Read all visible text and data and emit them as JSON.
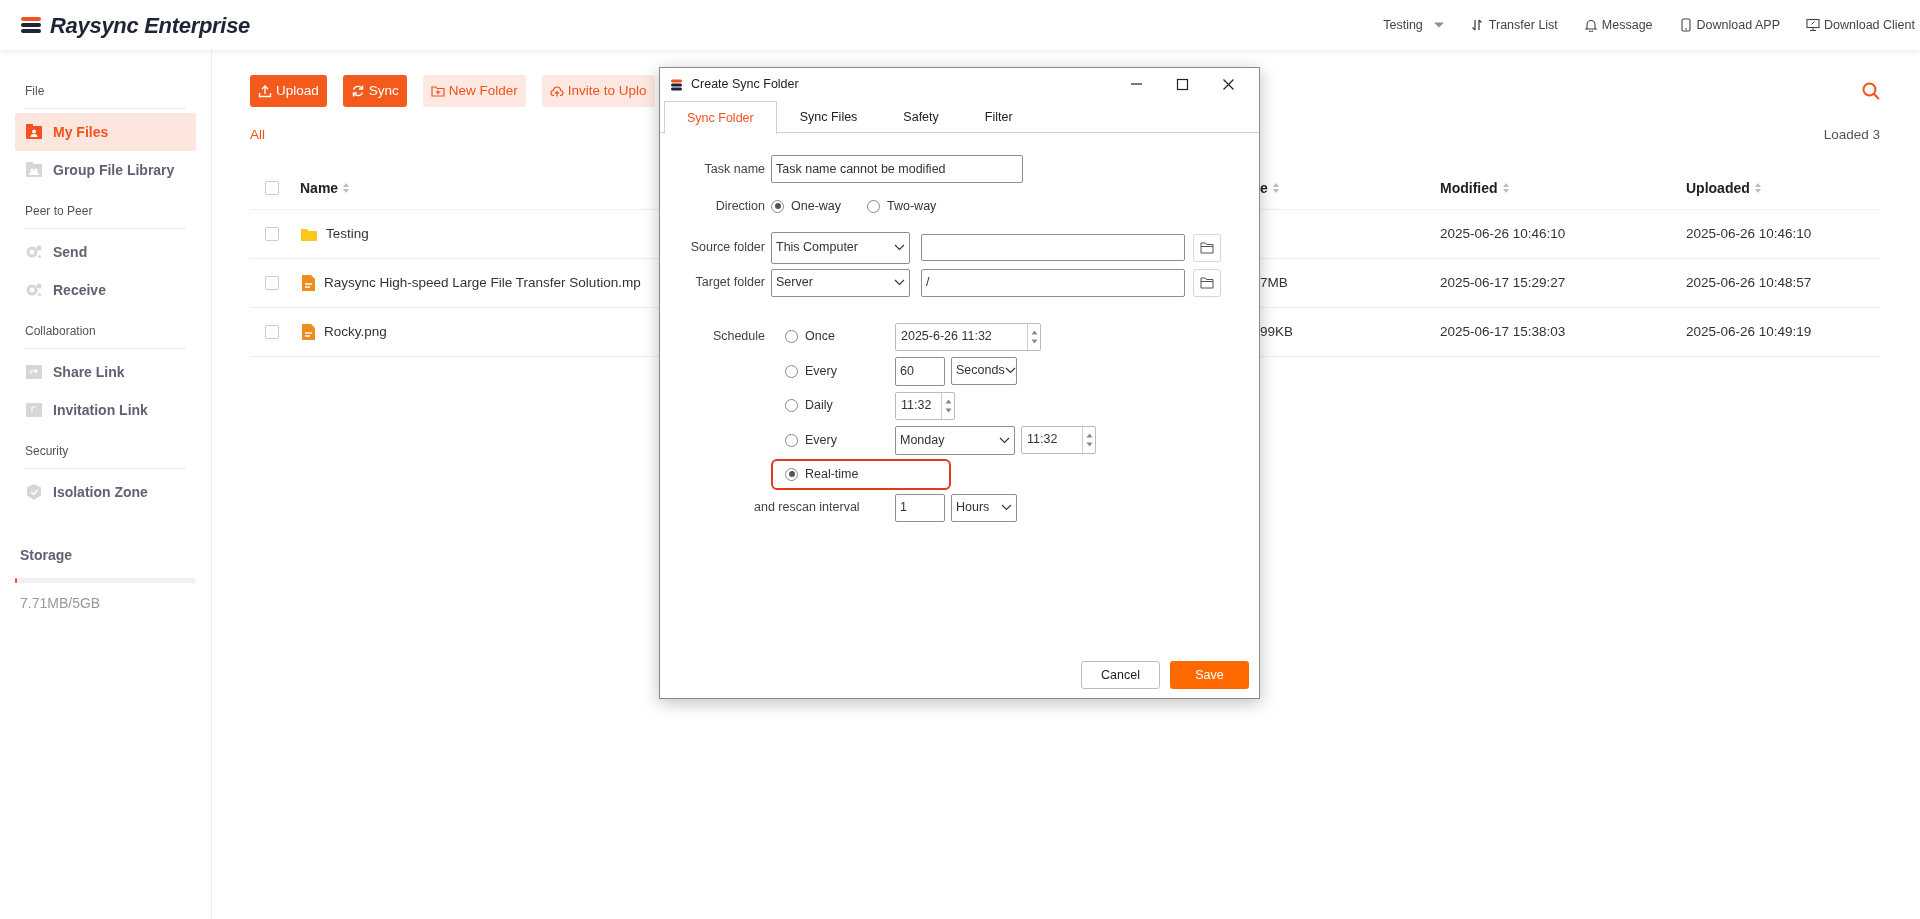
{
  "header": {
    "brand": "Raysync Enterprise",
    "nav": [
      {
        "label": "Testing",
        "kind": "dropdown"
      },
      {
        "label": "Transfer List",
        "kind": "transfer"
      },
      {
        "label": "Message",
        "kind": "bell"
      },
      {
        "label": "Download APP",
        "kind": "phone"
      },
      {
        "label": "Download Client",
        "kind": "monitor"
      }
    ]
  },
  "sidebar": {
    "sections": [
      {
        "title": "File",
        "items": [
          {
            "label": "My Files",
            "kind": "files",
            "selected": true
          },
          {
            "label": "Group File Library",
            "kind": "group",
            "selected": false
          }
        ]
      },
      {
        "title": "Peer to Peer",
        "items": [
          {
            "label": "Send",
            "kind": "send",
            "selected": false
          },
          {
            "label": "Receive",
            "kind": "send",
            "selected": false
          }
        ]
      },
      {
        "title": "Collaboration",
        "items": [
          {
            "label": "Share Link",
            "kind": "share",
            "selected": false
          },
          {
            "label": "Invitation Link",
            "kind": "invite",
            "selected": false
          }
        ]
      },
      {
        "title": "Security",
        "items": [
          {
            "label": "Isolation Zone",
            "kind": "shield",
            "selected": false
          }
        ]
      }
    ],
    "storage": {
      "title": "Storage",
      "level": 0.012,
      "reading": "7.71MB/5GB"
    }
  },
  "toolbar": {
    "buttons": [
      {
        "label": "Upload",
        "kind": "primary"
      },
      {
        "label": "Sync",
        "kind": "primary"
      },
      {
        "label": "New Folder",
        "kind": "light"
      },
      {
        "label": "Invite to Uplo",
        "kind": "light"
      }
    ]
  },
  "breadcrumb": "All",
  "loaded": "Loaded 3",
  "table": {
    "select_all": false,
    "columns": [
      {
        "label": "Name"
      },
      {
        "label": "e"
      },
      {
        "label": "Modified"
      },
      {
        "label": "Uploaded"
      }
    ],
    "rows": [
      {
        "kind": "folder",
        "checked": false,
        "name": "Testing",
        "modified": "2025-06-26 10:46:10",
        "uploaded": "2025-06-26 10:46:10"
      },
      {
        "kind": "file",
        "checked": false,
        "name": "Raysync High-speed Large File Transfer Solution.mp",
        "size": "7MB",
        "modified": "2025-06-17 15:29:27",
        "uploaded": "2025-06-26 10:48:57"
      },
      {
        "kind": "file",
        "checked": false,
        "name": "Rocky.png",
        "size": "99KB",
        "modified": "2025-06-17 15:38:03",
        "uploaded": "2025-06-26 10:49:19"
      }
    ]
  },
  "dialog": {
    "title": "Create Sync Folder",
    "tabs": [
      {
        "label": "Sync Folder",
        "selected": true
      },
      {
        "label": "Sync Files",
        "selected": false
      },
      {
        "label": "Safety",
        "selected": false
      },
      {
        "label": "Filter",
        "selected": false
      }
    ],
    "task_name": {
      "label": "Task name",
      "value": "Task name cannot be modified"
    },
    "direction": {
      "label": "Direction",
      "options": [
        {
          "label": "One-way",
          "selected": true
        },
        {
          "label": "Two-way",
          "selected": false
        }
      ]
    },
    "source": {
      "label": "Source folder",
      "location": "This Computer"
    },
    "target": {
      "label": "Target folder",
      "location": "Server",
      "path": "/"
    },
    "schedule": {
      "label": "Schedule",
      "options": [
        {
          "label": "Once",
          "kind": "datetime",
          "selected": false,
          "highlighted": false,
          "value": "2025-6-26 11:32"
        },
        {
          "label": "Every",
          "kind": "interval",
          "selected": false,
          "highlighted": false,
          "value": "60",
          "unit": "Seconds"
        },
        {
          "label": "Daily",
          "kind": "time",
          "selected": false,
          "highlighted": false,
          "value": "11:32"
        },
        {
          "label": "Every",
          "kind": "weekly",
          "selected": false,
          "highlighted": false,
          "day": "Monday",
          "value": "11:32"
        },
        {
          "label": "Real-time",
          "kind": "none",
          "selected": true,
          "highlighted": true
        }
      ],
      "rescan": {
        "label": "and rescan interval",
        "value": "1",
        "unit": "Hours"
      }
    },
    "buttons": [
      {
        "label": "Cancel",
        "kind": "secondary"
      },
      {
        "label": "Save",
        "kind": "primary"
      }
    ]
  }
}
